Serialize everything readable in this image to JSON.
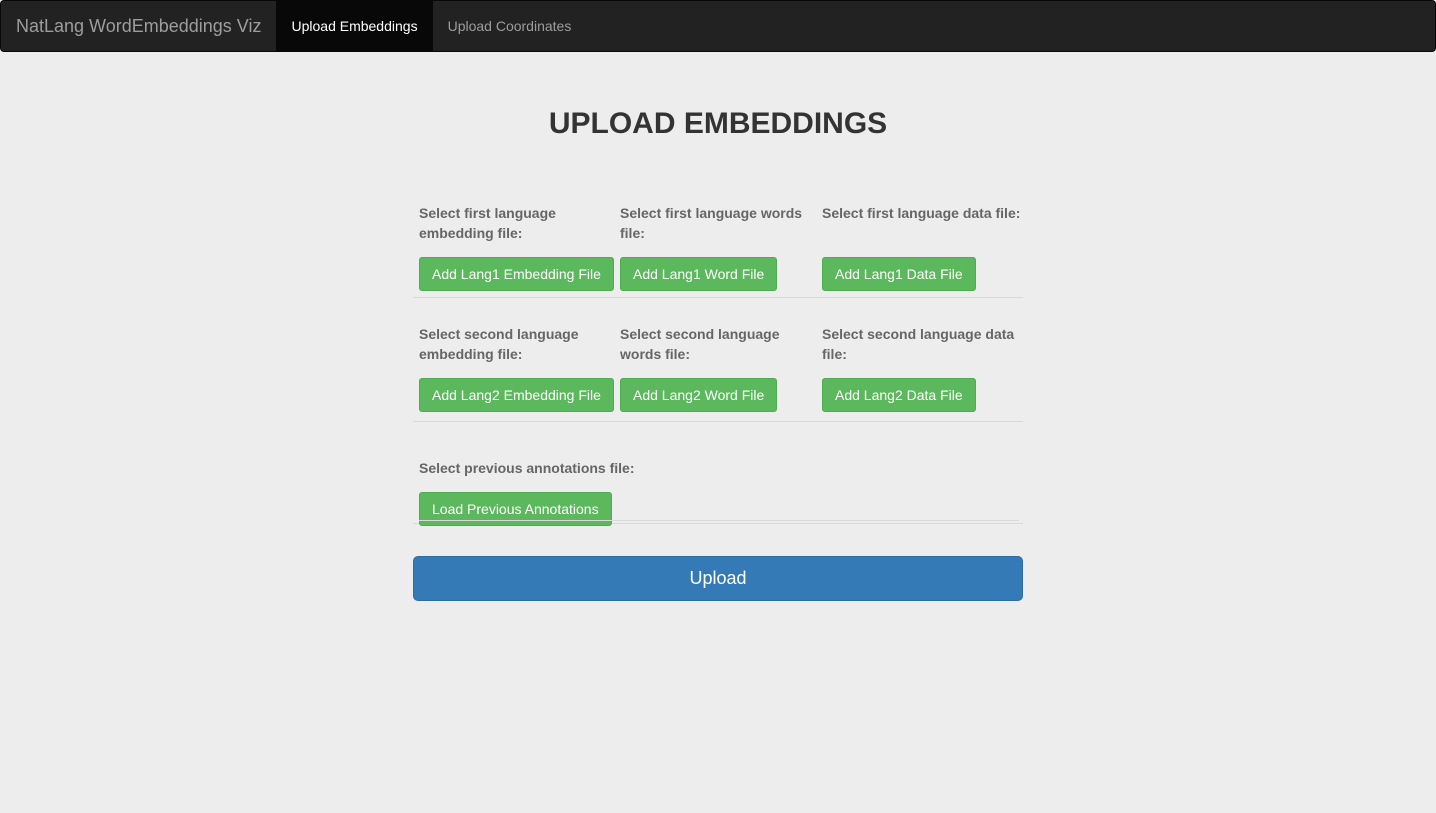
{
  "navbar": {
    "brand": "NatLang WordEmbeddings Viz",
    "items": [
      {
        "label": "Upload Embeddings",
        "active": true
      },
      {
        "label": "Upload Coordinates",
        "active": false
      }
    ]
  },
  "page": {
    "title": "UPLOAD EMBEDDINGS"
  },
  "lang1": {
    "embedding_label": "Select first language embedding file:",
    "embedding_button": "Add Lang1 Embedding File",
    "words_label": "Select first language words file:",
    "words_button": "Add Lang1 Word File",
    "data_label": "Select first language data file:",
    "data_button": "Add Lang1 Data File"
  },
  "lang2": {
    "embedding_label": "Select second language embedding file:",
    "embedding_button": "Add Lang2 Embedding File",
    "words_label": "Select second language words file:",
    "words_button": "Add Lang2 Word File",
    "data_label": "Select second language data file:",
    "data_button": "Add Lang2 Data File"
  },
  "annotations": {
    "label": "Select previous annotations file:",
    "button": "Load Previous Annotations"
  },
  "submit": {
    "label": "Upload"
  },
  "colors": {
    "navbar_bg": "#222222",
    "success": "#5cb85c",
    "primary": "#337ab7",
    "page_bg": "#ededed"
  }
}
